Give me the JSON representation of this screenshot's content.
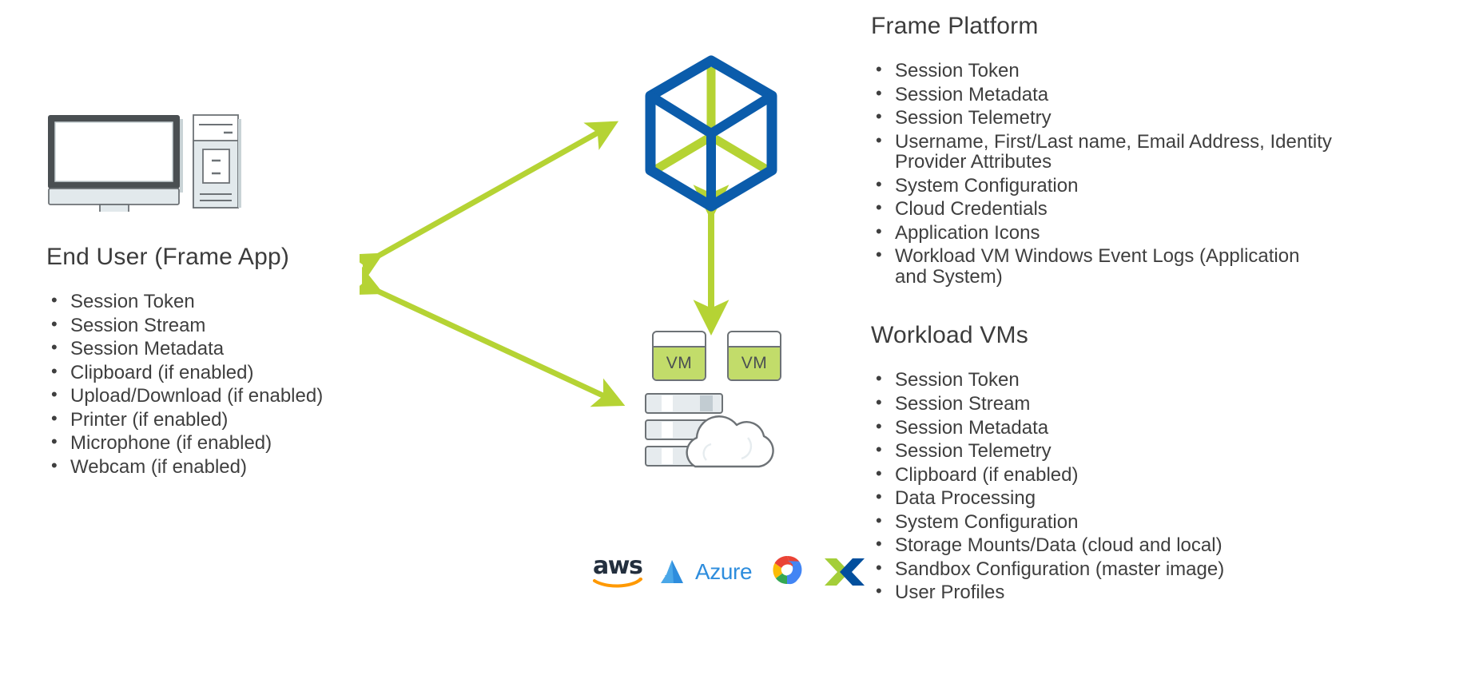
{
  "diagram": {
    "title_hidden": "",
    "accent_green": "#b5d334",
    "accent_blue": "#0b5cab",
    "vm_green": "#c2dc6a",
    "device_gray": "#4a4f52",
    "text_gray": "#3f3f3f"
  },
  "left": {
    "heading": "End User (Frame App)",
    "device_icon": "desktop-computer-icon",
    "bullets": [
      "Session Token",
      "Session Stream",
      "Session Metadata",
      "Clipboard (if enabled)",
      "Upload/Download (if enabled)",
      "Printer (if enabled)",
      "Microphone (if enabled)",
      "Webcam (if enabled)"
    ]
  },
  "right": {
    "frame_platform": {
      "heading": "Frame Platform",
      "bullets": [
        "Session Token",
        "Session Metadata",
        "Session Telemetry",
        "Username, First/Last name, Email Address, Identity Provider Attributes",
        "System Configuration",
        "Cloud Credentials",
        "Application Icons",
        "Workload VM Windows Event Logs (Application and System)"
      ]
    },
    "workload_vms": {
      "heading": "Workload VMs",
      "bullets": [
        "Session Token",
        "Session Stream",
        "Session Metadata",
        "Session Telemetry",
        "Clipboard (if enabled)",
        "Data Processing",
        "System Configuration",
        "Storage Mounts/Data (cloud and local)",
        "Sandbox Configuration (master image)",
        "User Profiles"
      ]
    }
  },
  "center": {
    "platform_icon": "frame-cube-icon",
    "vm_boxes": [
      {
        "label": "VM"
      },
      {
        "label": "VM"
      }
    ],
    "cloud_icon": "server-cloud-icon",
    "cloud_providers": [
      {
        "name": "aws-logo",
        "label": "aws"
      },
      {
        "name": "azure-logo",
        "label": "Azure"
      },
      {
        "name": "google-cloud-logo",
        "label": ""
      },
      {
        "name": "nutanix-x-logo",
        "label": ""
      }
    ],
    "arrows": [
      {
        "name": "arrow-enduser-to-platform",
        "direction": "bidirectional"
      },
      {
        "name": "arrow-enduser-to-workload",
        "direction": "bidirectional"
      },
      {
        "name": "arrow-platform-to-workload",
        "direction": "bidirectional"
      }
    ]
  }
}
